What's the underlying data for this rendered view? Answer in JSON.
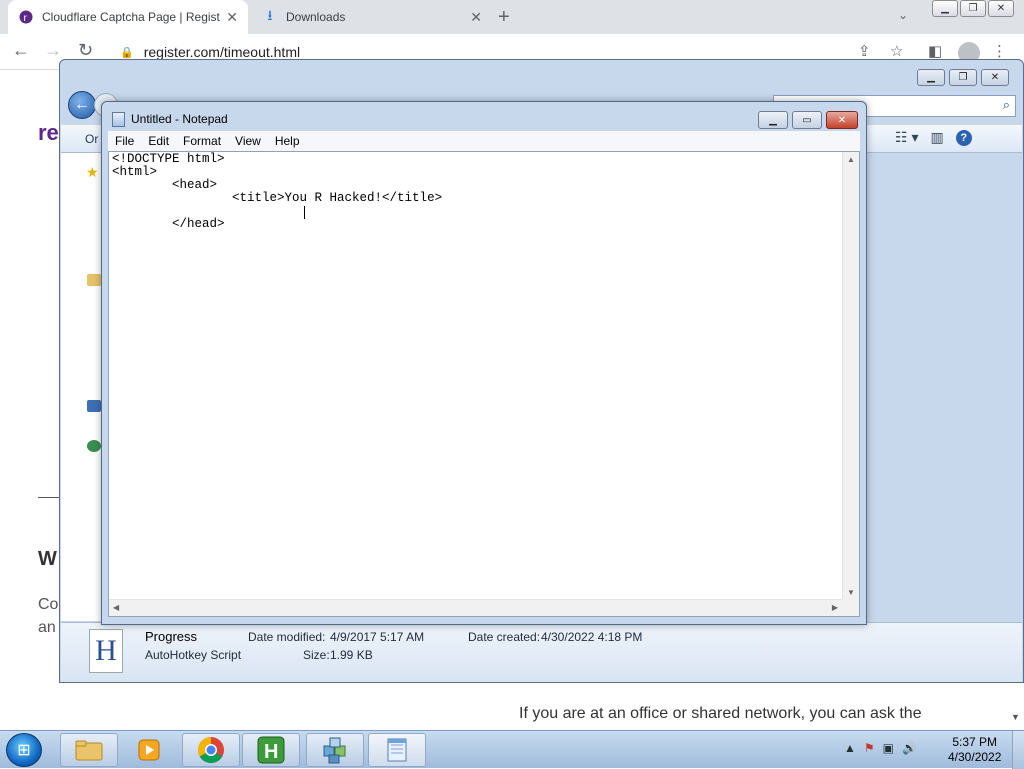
{
  "browser": {
    "tabs": [
      {
        "title": "Cloudflare Captcha Page | Regist"
      },
      {
        "title": "Downloads"
      }
    ],
    "url": "register.com/timeout.html"
  },
  "page": {
    "logo_text": "re",
    "heading_fragment": "W",
    "para_line1_fragment": "Co",
    "para_line2_fragment": "an",
    "bottom_text": "If you are at an office or shared network, you can ask the"
  },
  "explorer": {
    "command_fragment": "Or",
    "details": {
      "name": "Progress",
      "type": "AutoHotkey Script",
      "date_modified_label": "Date modified:",
      "date_modified": "4/9/2017 5:17 AM",
      "date_created_label": "Date created:",
      "date_created": "4/30/2022 4:18 PM",
      "size_label": "Size:",
      "size": "1.99 KB"
    }
  },
  "notepad": {
    "title": "Untitled - Notepad",
    "menu": [
      "File",
      "Edit",
      "Format",
      "View",
      "Help"
    ],
    "content": "<!DOCTYPE html>\n<html>\n\t<head>\n\t\t<title>You R Hacked!</title>\n\n\t</head>"
  },
  "taskbar": {
    "time": "5:37 PM",
    "date": "4/30/2022"
  }
}
